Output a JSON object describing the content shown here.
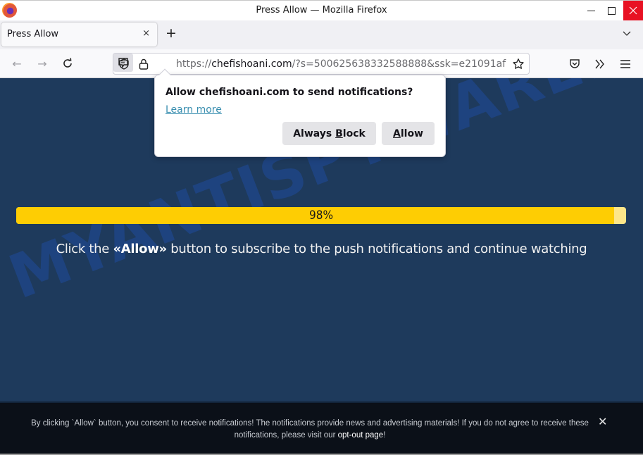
{
  "window": {
    "title": "Press Allow — Mozilla Firefox",
    "controls": {
      "minimize": "minimize-icon",
      "maximize": "maximize-icon",
      "close": "close-icon"
    }
  },
  "tabs": [
    {
      "label": "Press Allow",
      "active": true,
      "close_glyph": "×"
    }
  ],
  "tabstrip": {
    "new_tab_glyph": "+"
  },
  "navbar": {
    "back_glyph": "←",
    "forward_glyph": "→",
    "reload_glyph": "↻",
    "url_scheme": "https://",
    "url_host": "chefishoani.com",
    "url_rest": "/?s=500625638332588888&ssk=e21091af"
  },
  "permission_popup": {
    "title": "Allow chefishoani.com to send notifications?",
    "learn_more": "Learn more",
    "block_button": {
      "pre": "Always ",
      "accel": "B",
      "post": "lock"
    },
    "allow_button": {
      "pre": "",
      "accel": "A",
      "post": "llow"
    }
  },
  "page": {
    "watermark": "MYANTISPYWARE.COM",
    "progress": {
      "value_percent": 98,
      "label": "98%",
      "fill_color": "#fecd03",
      "track_color": "#fde68a"
    },
    "instruction": {
      "before": "Click the ",
      "bold": "«Allow»",
      "after": " button to subscribe to the push notifications and continue watching"
    },
    "background_color": "#1e3a5c"
  },
  "footer": {
    "text": "By clicking `Allow` button, you consent to receive notifications! The notifications provide news and advertising materials! If you do not agree to receive these notifications, please visit our ",
    "link": "opt-out page",
    "text_end": "!",
    "close_glyph": "✕"
  }
}
